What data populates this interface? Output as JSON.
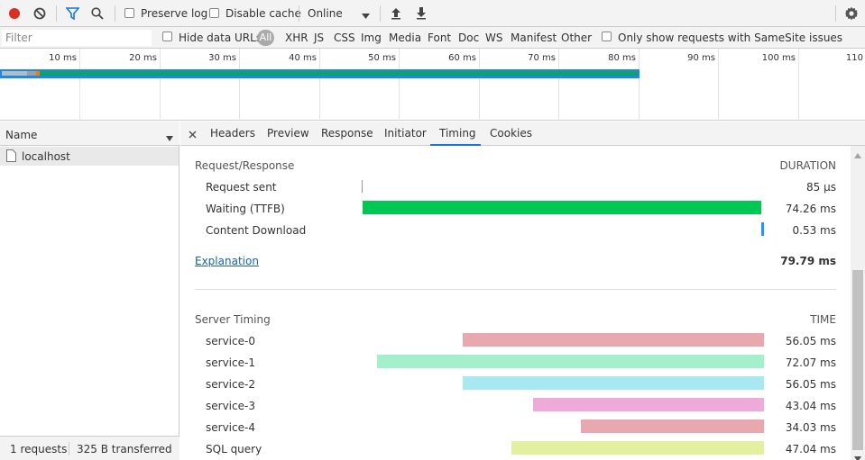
{
  "toolbar": {
    "preserve_log": "Preserve log",
    "disable_cache": "Disable cache",
    "throttle": "Online"
  },
  "filterbar": {
    "placeholder": "Filter",
    "hide_data_urls": "Hide data URLs",
    "all": "All",
    "types": [
      "XHR",
      "JS",
      "CSS",
      "Img",
      "Media",
      "Font",
      "Doc",
      "WS",
      "Manifest",
      "Other"
    ],
    "samesite": "Only show requests with SameSite issues"
  },
  "overview": {
    "ticks": [
      "10 ms",
      "20 ms",
      "30 ms",
      "40 ms",
      "50 ms",
      "60 ms",
      "70 ms",
      "80 ms",
      "90 ms",
      "100 ms",
      "110"
    ]
  },
  "left": {
    "name_header": "Name",
    "request": "localhost",
    "status_requests": "1 requests",
    "status_transferred": "325 B transferred"
  },
  "tabs": [
    "Headers",
    "Preview",
    "Response",
    "Initiator",
    "Timing",
    "Cookies"
  ],
  "timing": {
    "request_response_title": "Request/Response",
    "duration_label": "DURATION",
    "rows": [
      {
        "label": "Request sent",
        "value": "85 µs",
        "fraction_start": 0.0,
        "fraction_width": 0.002
      },
      {
        "label": "Waiting (TTFB)",
        "value": "74.26 ms",
        "fraction_start": 0.0,
        "fraction_width": 0.994
      },
      {
        "label": "Content Download",
        "value": "0.53 ms",
        "fraction_start": 0.994,
        "fraction_width": 0.006
      }
    ],
    "explanation": "Explanation",
    "total": "79.79 ms",
    "server_timing_title": "Server Timing",
    "time_label": "TIME",
    "server_rows": [
      {
        "label": "service-0",
        "value": "56.05 ms",
        "color": "#e8a8b0"
      },
      {
        "label": "service-1",
        "value": "72.07 ms",
        "color": "#a4f0cc"
      },
      {
        "label": "service-2",
        "value": "56.05 ms",
        "color": "#a8e8f0"
      },
      {
        "label": "service-3",
        "value": "43.04 ms",
        "color": "#eeaad8"
      },
      {
        "label": "service-4",
        "value": "34.03 ms",
        "color": "#e8a8b0"
      },
      {
        "label": "SQL query",
        "value": "47.04 ms",
        "color": "#e2f0a0"
      }
    ]
  },
  "colors": {
    "record": "#d93025",
    "filter_blue": "#1a73e8",
    "ttfb": "#00c853",
    "download": "#2196f3",
    "waterfall_green": "#0aa36c"
  }
}
